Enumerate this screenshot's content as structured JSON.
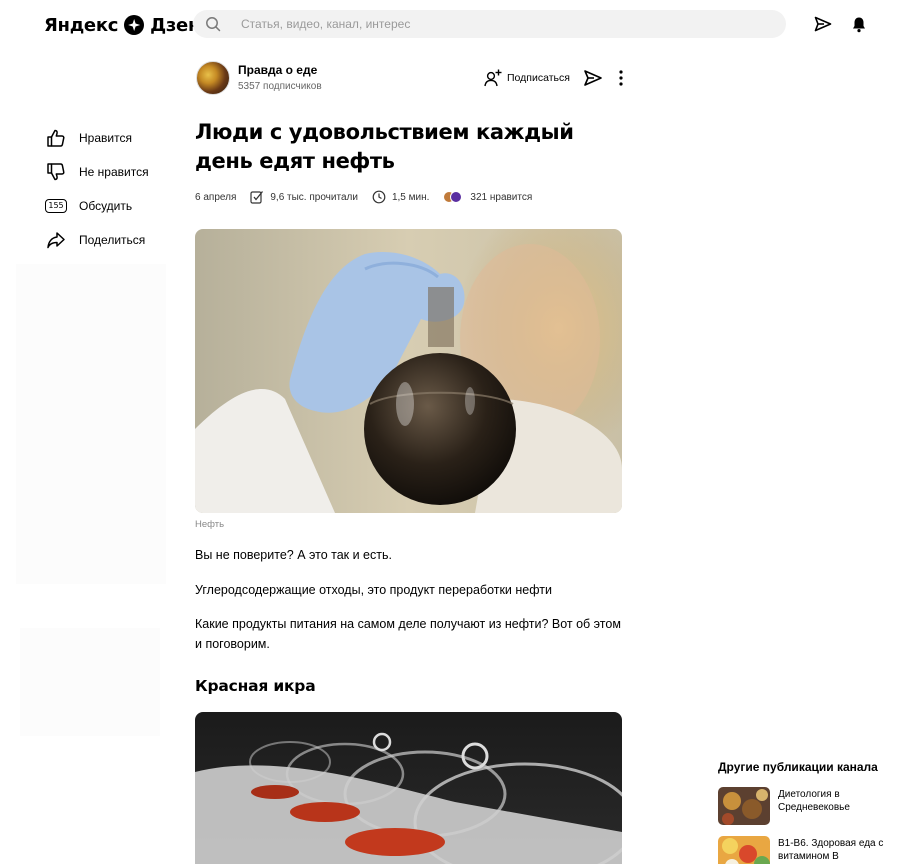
{
  "header": {
    "logo_text_1": "Яндекс",
    "logo_text_2": "Дзен",
    "search_placeholder": "Статья, видео, канал, интерес",
    "icons": [
      "search-icon",
      "share-icon",
      "bell-icon"
    ]
  },
  "channel": {
    "name": "Правда о еде",
    "subscribers": "5357 подписчиков",
    "subscribe_label": "Подписаться"
  },
  "actions": {
    "like": "Нравится",
    "dislike": "Не нравится",
    "comment": "Обсудить",
    "comment_count": "155",
    "share": "Поделиться"
  },
  "article": {
    "title": "Люди с удовольствием каждый день едят нефть",
    "date": "6 апреля",
    "reads": "9,6 тыс. прочитали",
    "read_time": "1,5 мин.",
    "likes": "321 нравится",
    "image_caption": "Нефть",
    "paragraphs": [
      "Вы не поверите? А это так и есть.",
      "Углеродсодержащие отходы, это продукт переработки нефти",
      "Какие продукты питания на самом деле получают из нефти? Вот об этом и поговорим."
    ],
    "subheading": "Красная икра"
  },
  "sidebar": {
    "title": "Другие публикации канала",
    "items": [
      {
        "title": "Диетология в Средневековье"
      },
      {
        "title": "В1-В6. Здоровая еда с витамином В"
      }
    ]
  },
  "colors": {
    "background": "#ffffff",
    "search_bg": "#f2f2f2",
    "text": "#000000",
    "muted": "#888888"
  }
}
